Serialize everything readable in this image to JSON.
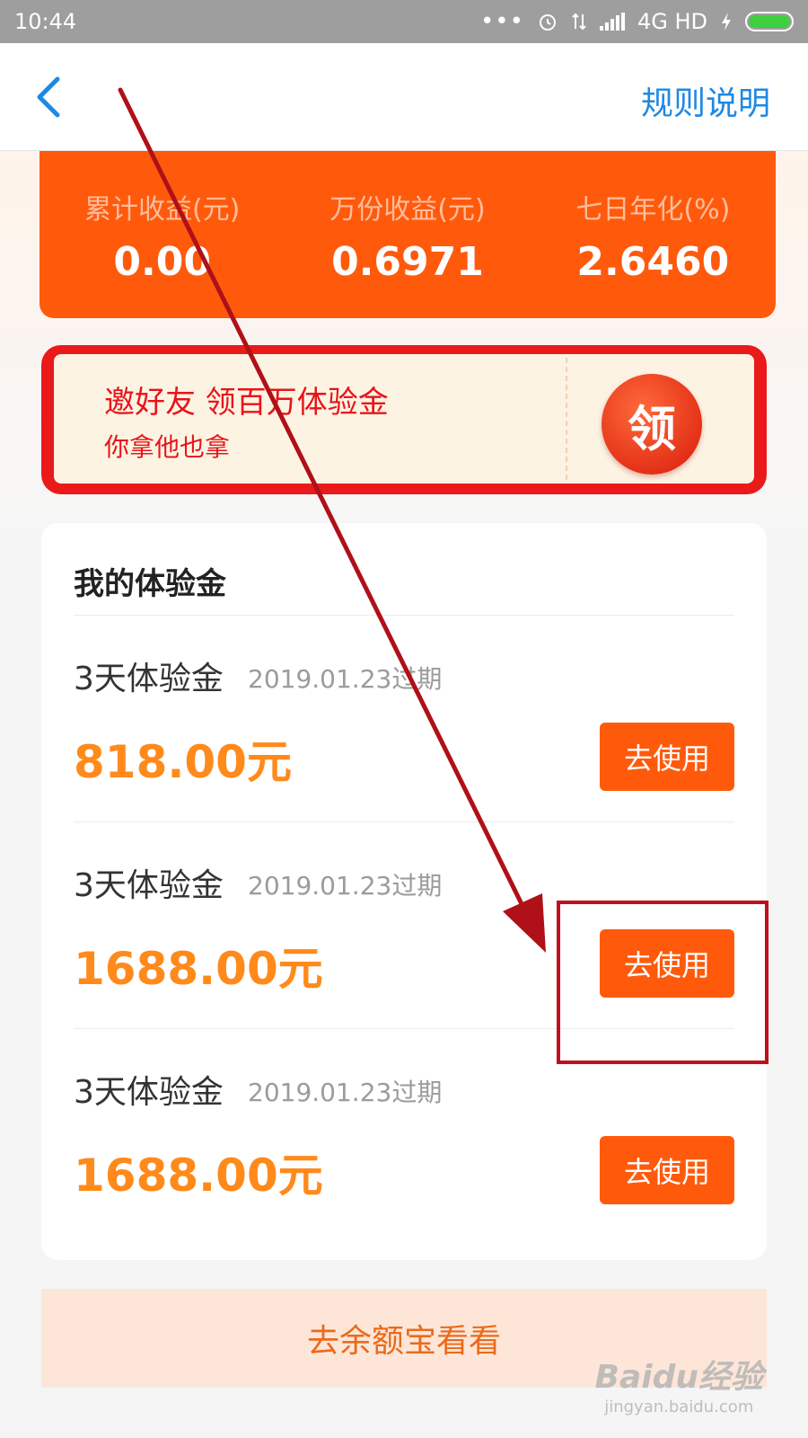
{
  "status_bar": {
    "time": "10:44",
    "network": "4G HD"
  },
  "nav": {
    "rules_link": "规则说明"
  },
  "stats": [
    {
      "label": "累计收益(元)",
      "value": "0.00"
    },
    {
      "label": "万份收益(元)",
      "value": "0.6971"
    },
    {
      "label": "七日年化(%)",
      "value": "2.6460"
    }
  ],
  "invite": {
    "title": "邀好友  领百万体验金",
    "subtitle": "你拿他也拿",
    "button": "领"
  },
  "funds": {
    "title": "我的体验金",
    "items": [
      {
        "name": "3天体验金",
        "expire": "2019.01.23过期",
        "amount": "818.00元",
        "button": "去使用"
      },
      {
        "name": "3天体验金",
        "expire": "2019.01.23过期",
        "amount": "1688.00元",
        "button": "去使用"
      },
      {
        "name": "3天体验金",
        "expire": "2019.01.23过期",
        "amount": "1688.00元",
        "button": "去使用"
      }
    ]
  },
  "footer": {
    "button": "去余额宝看看"
  },
  "watermark": {
    "logo": "Baidu经验",
    "site": "jingyan.baidu.com"
  },
  "colors": {
    "accent_orange": "#ff5a0c",
    "amount_orange": "#ff8a1c",
    "link_blue": "#1e88e5",
    "invite_red": "#e8141b",
    "annotation_red": "#c0101c"
  }
}
